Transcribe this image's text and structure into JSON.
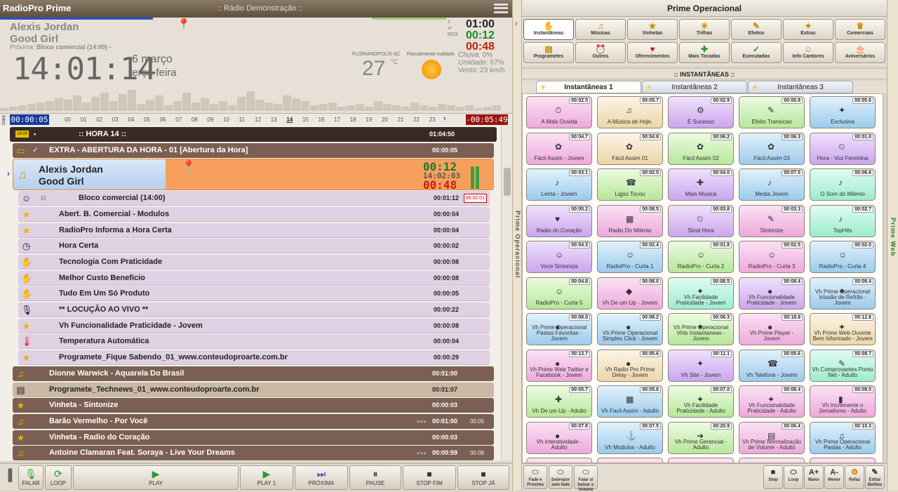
{
  "app": {
    "name": "RadioPro Prime",
    "station": ":: Rádio Demonstração ::"
  },
  "now": {
    "artist": "Alexis Jordan",
    "title": "Good Girl",
    "next_label": "Próxima:",
    "next_value": "Bloco comercial (14:00) -"
  },
  "clock": {
    "time": "14:01:14",
    "day": "6  março",
    "weekday": "terça-feira"
  },
  "weather": {
    "city": "FLORIANOPOLIS-SC",
    "temp": "27",
    "unit": "°C",
    "condition": "Parcialmente nublado",
    "rain": "Chuva: 0%",
    "humidity": "Umidade: 67%",
    "wind": "Vento: 23 km/h"
  },
  "counters": {
    "total": "01:00",
    "elapsed": "00:12",
    "remaining": "00:48"
  },
  "indicators": [
    "1",
    "RDS"
  ],
  "timeline": {
    "intro": "Intro",
    "start": "00:00:05",
    "end": "-00:05:49",
    "ticks": [
      "00",
      "01",
      "02",
      "03",
      "04",
      "05",
      "06",
      "07",
      "08",
      "09",
      "10",
      "11",
      "12",
      "13",
      "14",
      "15",
      "16",
      "17",
      "18",
      "19",
      "20",
      "21",
      "22",
      "23"
    ],
    "current": "14"
  },
  "hour_row": {
    "badge": "13:00",
    "name": ":: HORA 14 ::",
    "duration": "01:04:50"
  },
  "current": {
    "artist": "Alexis Jordan",
    "title": "Good Girl",
    "t_elapsed": "00:12",
    "t_time": "14:02:03",
    "t_remaining": "00:48"
  },
  "rows": [
    {
      "style": "brown",
      "icon": "folder-icon",
      "name": "EXTRA - ABERTURA DA HORA - 01  [Abertura da Hora]",
      "dur": "00:00:05"
    },
    {
      "style": "lav",
      "icon": "person-icon",
      "name": "Bloco comercial (14:00)",
      "dur": "00:01:12",
      "extra": "00:02:01"
    },
    {
      "style": "lav",
      "icon": "star-icon",
      "name": "Abert. B. Comercial - Modulos",
      "dur": "00:00:04"
    },
    {
      "style": "lav",
      "icon": "star-icon",
      "name": "RadioPro Informa a Hora Certa",
      "dur": "00:00:04"
    },
    {
      "style": "lav",
      "icon": "clock-icon",
      "name": "Hora Certa",
      "dur": "00:00:02"
    },
    {
      "style": "lav",
      "icon": "hand-icon",
      "name": "Tecnologia Com Praticidade",
      "dur": "00:00:08"
    },
    {
      "style": "lav",
      "icon": "hand-icon",
      "name": "Melhor Custo Benefício",
      "dur": "00:00:08"
    },
    {
      "style": "lav",
      "icon": "hand-icon",
      "name": "Tudo Em Um Só Produto",
      "dur": "00:00:05"
    },
    {
      "style": "lav",
      "icon": "mic-icon",
      "name": "** LOCUÇÃO AO VIVO **",
      "dur": "00:00:22"
    },
    {
      "style": "lav",
      "icon": "star-icon",
      "name": "Vh Funcionalidade Praticidade - Jovem",
      "dur": "00:00:08"
    },
    {
      "style": "lav",
      "icon": "thermometer-icon",
      "name": "Temperatura Automática",
      "dur": "00:00:04"
    },
    {
      "style": "lav",
      "icon": "star-icon",
      "name": "Programete_Fique Sabendo_01_www.conteudoproarte.com.br",
      "dur": "00:00:29"
    },
    {
      "style": "brown",
      "icon": "note-icon",
      "name": "Dionne Warwick - Aquarela Do Brasil",
      "dur": "00:01:00"
    },
    {
      "style": "tan",
      "icon": "film-icon",
      "name": "Programete_Technews_01_www.conteudoproarte.com.br",
      "dur": "00:01:07"
    },
    {
      "style": "brown",
      "icon": "star-icon",
      "name": "Vinheta - Sintonize",
      "dur": "00:00:03"
    },
    {
      "style": "brown",
      "icon": "note-icon",
      "name": "Barão Vermelho - Por Você",
      "dur": "00:01:00",
      "extra": "00:05"
    },
    {
      "style": "brown",
      "icon": "star-icon",
      "name": "Vinheta - Radio do Coração",
      "dur": "00:00:03"
    },
    {
      "style": "brown",
      "icon": "note-icon",
      "name": "Antoine Clamaran Feat. Soraya - Live Your Dreams",
      "dur": "00:00:59",
      "extra": "00:08"
    }
  ],
  "controls": [
    {
      "label": "FALAR",
      "sym": "🎙"
    },
    {
      "label": "LOOP",
      "sym": "⟳"
    },
    {
      "label": "PLAY",
      "sym": "▶"
    },
    {
      "label": "PLAY 1",
      "sym": "▶"
    },
    {
      "label": "PRÓXIMA",
      "sym": "⏭"
    },
    {
      "label": "PAUSE",
      "sym": "⏸"
    },
    {
      "label": "STOP FIM",
      "sym": "⏹"
    },
    {
      "label": "STOP JÁ",
      "sym": "⏹"
    }
  ],
  "side_labels": {
    "left": "Prime Operacional",
    "right": "Prime Web"
  },
  "right_panel": {
    "title": "Prime Operacional",
    "categories": [
      "Instantâneas",
      "Músicas",
      "Vinhetas",
      "Trilhas",
      "Efeitos",
      "Extras",
      "Comerciais",
      "Programetes",
      "Outros",
      "Oferecimentos",
      "Mais Tocadas",
      "Executadas",
      "Info Cantores",
      "Aniversários"
    ],
    "section": ":: INSTANTÂNEAS ::",
    "tabs": [
      "Instantâneas 1",
      "Instantâneas 2",
      "Instantâneas 3"
    ],
    "cells": [
      {
        "t": "00:02.5",
        "l": "A Mais Ouvida",
        "c": "pink",
        "i": "⏱"
      },
      {
        "t": "00:05.7",
        "l": "A Música de Hoje.",
        "c": "cream",
        "i": "♫"
      },
      {
        "t": "00:02.9",
        "l": "É Sucesso",
        "c": "purp",
        "i": "⚙"
      },
      {
        "t": "00:00.8",
        "l": "Efeito Transicao",
        "c": "green",
        "i": "✎"
      },
      {
        "t": "00:05.6",
        "l": "Exclusiva",
        "c": "blue2",
        "i": "✦"
      },
      {
        "t": "00:04.7",
        "l": "Fácil Assim - Jovem",
        "c": "pink",
        "i": "✿"
      },
      {
        "t": "00:04.8",
        "l": "Fácil Assim 01",
        "c": "cream",
        "i": "✿"
      },
      {
        "t": "00:06.2",
        "l": "Fácil Assim 02",
        "c": "green",
        "i": "✿"
      },
      {
        "t": "00:06.3",
        "l": "Fácil Assim 03",
        "c": "blue2",
        "i": "✿"
      },
      {
        "t": "00:01.0",
        "l": "Hora - Voz Feminina",
        "c": "purp",
        "i": "⏲"
      },
      {
        "t": "00:03.1",
        "l": "Lenta - Jovem",
        "c": "blue2",
        "i": "♪"
      },
      {
        "t": "00:02.5",
        "l": "Ligou Tocou",
        "c": "green",
        "i": "☎"
      },
      {
        "t": "00:04.0",
        "l": "Mais Musica",
        "c": "purp",
        "i": "✚"
      },
      {
        "t": "00:07.5",
        "l": "Media Jovem",
        "c": "blue2",
        "i": "♪"
      },
      {
        "t": "00:06.6",
        "l": "O Som do Milenio",
        "c": "mint",
        "i": "♪"
      },
      {
        "t": "00:05.2",
        "l": "Radio do Coração",
        "c": "purp",
        "i": "♥"
      },
      {
        "t": "00:08.5",
        "l": "Radio Do Milenio",
        "c": "pink",
        "i": "▦"
      },
      {
        "t": "00:03.8",
        "l": "Sinal Hora",
        "c": "purp",
        "i": "⏲"
      },
      {
        "t": "00:03.3",
        "l": "Sintonize",
        "c": "pink",
        "i": "✎"
      },
      {
        "t": "00:02.7",
        "l": "TopHits",
        "c": "mint",
        "i": "♪"
      },
      {
        "t": "00:04.3",
        "l": "Voce Sintoniza",
        "c": "purp",
        "i": "☺"
      },
      {
        "t": "00:02.4",
        "l": "RadioPro - Curta 1",
        "c": "blue2",
        "i": "☺"
      },
      {
        "t": "00:01.8",
        "l": "RadioPro - Curta 2",
        "c": "green",
        "i": "☺"
      },
      {
        "t": "00:02.5",
        "l": "RadioPro - Curta 3",
        "c": "pink",
        "i": "☺"
      },
      {
        "t": "00:02.0",
        "l": "RadioPro - Curta 4",
        "c": "blue2",
        "i": "☺"
      },
      {
        "t": "00:04.8",
        "l": "RadioPro - Curta 5",
        "c": "green",
        "i": "☺"
      },
      {
        "t": "00:06.0",
        "l": "Vh De um Up - Jovem",
        "c": "pink",
        "i": "◆"
      },
      {
        "t": "00:08.5",
        "l": "Vh Facilidade Praticidade - Jovem",
        "c": "mint",
        "i": "✦"
      },
      {
        "t": "00:08.4",
        "l": "Vh Funcionalidade Praticidade - Jovem",
        "c": "purp",
        "i": "●"
      },
      {
        "t": "00:09.4",
        "l": "Vh Prime Operacional Iclusão de Refrão - Jovem",
        "c": "blue2",
        "i": "✦"
      },
      {
        "t": "00:08.0",
        "l": "Vh Prime Operacional Pastas Favoritas - Jovem",
        "c": "blue2",
        "i": "●"
      },
      {
        "t": "00:06.2",
        "l": "Vh Prime Operacional Simples Click - Jovem",
        "c": "blue2",
        "i": "●"
      },
      {
        "t": "00:06.3",
        "l": "Vh Prime Operacional Vhts Instantaneas - Jovem",
        "c": "green",
        "i": "✦"
      },
      {
        "t": "00:18.8",
        "l": "Vh Prime Player - Jovem",
        "c": "pink",
        "i": "●"
      },
      {
        "t": "00:12.6",
        "l": "Vh Prime Web Ouvinte Bem Informado - Jovem",
        "c": "cream",
        "i": "✦"
      },
      {
        "t": "00:13.7",
        "l": "Vh Prime Web Twitter e Facebook - Jovem",
        "c": "pink",
        "i": "●"
      },
      {
        "t": "00:05.6",
        "l": "Vh Radio Pro Prime Delay - Jovem",
        "c": "cream",
        "i": "●"
      },
      {
        "t": "00:11.1",
        "l": "Vh Site - Jovem",
        "c": "purp",
        "i": "✦"
      },
      {
        "t": "00:05.6",
        "l": "Vh Telefone - Jovem",
        "c": "blue2",
        "i": "☎"
      },
      {
        "t": "00:09.7",
        "l": "Vh Comprovantes Ponto Net - Adulto",
        "c": "mint",
        "i": "✎"
      },
      {
        "t": "00:05.7",
        "l": "Vh De um Up - Adulto",
        "c": "green",
        "i": "✚"
      },
      {
        "t": "00:05.6",
        "l": "Vh Facil Assim - Adulto",
        "c": "blue2",
        "i": "▦"
      },
      {
        "t": "00:07.0",
        "l": "Vh Facilidade Praticidade - Adulto",
        "c": "green",
        "i": "✦"
      },
      {
        "t": "00:08.4",
        "l": "Vh Funcionalidade Praticidade - Adulto",
        "c": "pink",
        "i": "✦"
      },
      {
        "t": "00:09.0",
        "l": "Vh Incremente o Jornalismo - Adulto",
        "c": "pink",
        "i": "▮"
      },
      {
        "t": "00:07.8",
        "l": "Vh Interatividade - Adulto",
        "c": "pink",
        "i": "●"
      },
      {
        "t": "00:07.5",
        "l": "Vh Modulos - Adulto",
        "c": "blue2",
        "i": "⚓"
      },
      {
        "t": "00:20.9",
        "l": "Vh Prime Gerencial - Adulto",
        "c": "green",
        "i": "➜"
      },
      {
        "t": "00:06.4",
        "l": "Vh Prime Normalização de Volume - Adulto",
        "c": "pink",
        "i": "▤"
      },
      {
        "t": "00:10.3",
        "l": "Vh Prime Operacional Pastas - Adulto",
        "c": "blue2",
        "i": "♫"
      }
    ],
    "bottom_left": [
      "Fade e Próxima",
      "Sobrepor sem fade",
      "Falar s/ baixar o Volume"
    ],
    "bottom_right": [
      "Stop",
      "Loop",
      "Maior",
      "Menor",
      "Refaz",
      "Editar Botões"
    ]
  }
}
